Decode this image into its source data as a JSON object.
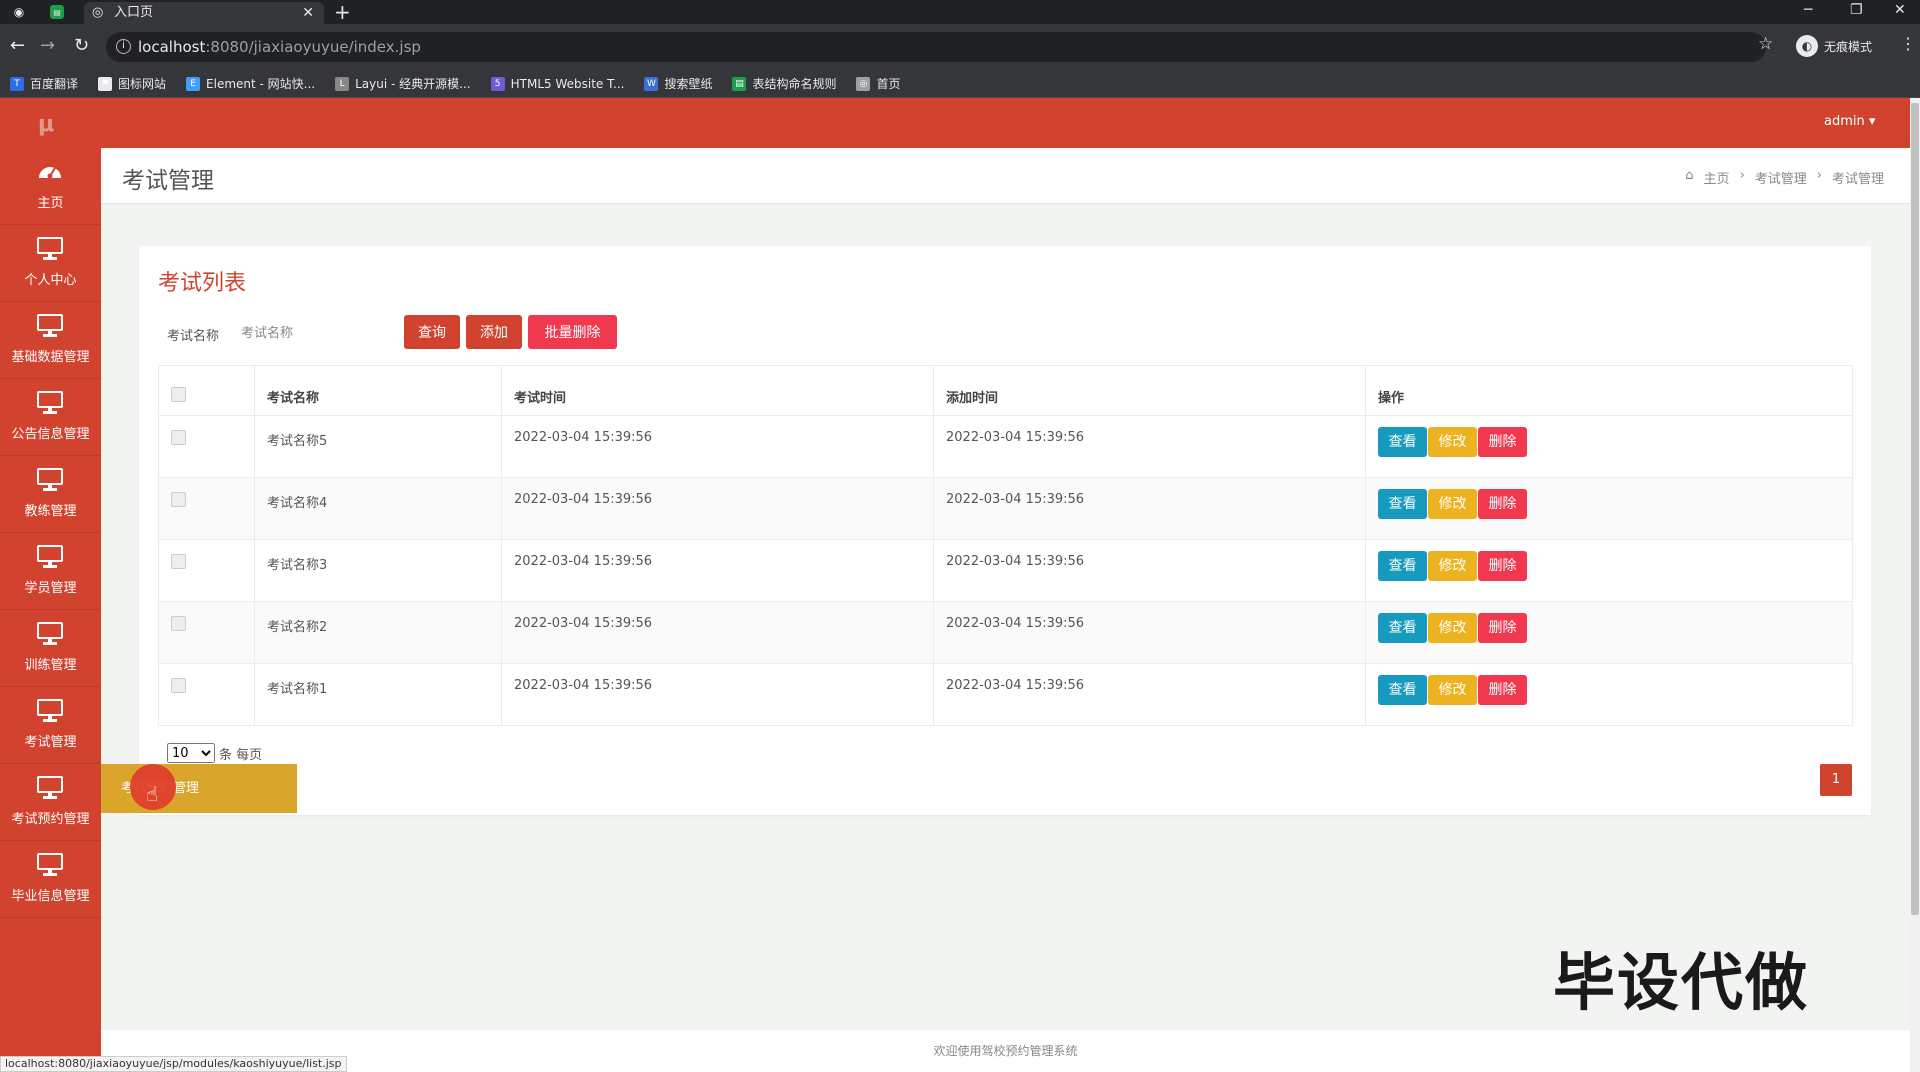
{
  "browser": {
    "tab_title": "入口页",
    "url_host": "localhost",
    "url_path": ":8080/jiaxiaoyuyue/index.jsp",
    "incognito_label": "无痕模式",
    "bookmarks": [
      {
        "label": "百度翻译",
        "color": "#2b6de4",
        "icon": "baidu-translate-icon",
        "glyph": "T"
      },
      {
        "label": "图标网站",
        "color": "#e8eaed",
        "icon": "flag-icon",
        "glyph": "⚑"
      },
      {
        "label": "Element - 网站快...",
        "color": "#409eff",
        "icon": "element-icon",
        "glyph": "E"
      },
      {
        "label": "Layui - 经典开源模...",
        "color": "#888888",
        "icon": "layui-icon",
        "glyph": "L"
      },
      {
        "label": "HTML5 Website T...",
        "color": "#6e5bd6",
        "icon": "html5-icon",
        "glyph": "5"
      },
      {
        "label": "搜索壁纸",
        "color": "#3b6fd8",
        "icon": "wallpaper-icon",
        "glyph": "W"
      },
      {
        "label": "表结构命名规则",
        "color": "#1e9e4a",
        "icon": "sheet-icon",
        "glyph": "▤"
      },
      {
        "label": "首页",
        "color": "#9aa0a6",
        "icon": "globe-icon",
        "glyph": "◎"
      }
    ],
    "status_url": "localhost:8080/jiaxiaoyuyue/jsp/modules/kaoshiyuyue/list.jsp"
  },
  "app": {
    "logo": "μ",
    "user_menu": "admin ▾",
    "sidebar": [
      {
        "label": "主页",
        "icon": "dashboard-icon"
      },
      {
        "label": "个人中心",
        "icon": "monitor-icon"
      },
      {
        "label": "基础数据管理",
        "icon": "monitor-icon"
      },
      {
        "label": "公告信息管理",
        "icon": "monitor-icon"
      },
      {
        "label": "教练管理",
        "icon": "monitor-icon"
      },
      {
        "label": "学员管理",
        "icon": "monitor-icon"
      },
      {
        "label": "训练管理",
        "icon": "monitor-icon"
      },
      {
        "label": "考试管理",
        "icon": "monitor-icon"
      },
      {
        "label": "考试预约管理",
        "icon": "monitor-icon"
      },
      {
        "label": "毕业信息管理",
        "icon": "monitor-icon"
      }
    ],
    "flyout_label": "考试预约管理",
    "page_title": "考试管理",
    "breadcrumb": [
      "主页",
      "考试管理",
      "考试管理"
    ],
    "card_title": "考试列表",
    "search": {
      "label": "考试名称",
      "placeholder": "考试名称"
    },
    "buttons": {
      "search": "查询",
      "add": "添加",
      "batch_delete": "批量删除"
    },
    "table": {
      "headers": [
        "考试名称",
        "考试时间",
        "添加时间",
        "操作"
      ],
      "rows": [
        {
          "name": "考试名称5",
          "exam_time": "2022-03-04 15:39:56",
          "add_time": "2022-03-04 15:39:56"
        },
        {
          "name": "考试名称4",
          "exam_time": "2022-03-04 15:39:56",
          "add_time": "2022-03-04 15:39:56"
        },
        {
          "name": "考试名称3",
          "exam_time": "2022-03-04 15:39:56",
          "add_time": "2022-03-04 15:39:56"
        },
        {
          "name": "考试名称2",
          "exam_time": "2022-03-04 15:39:56",
          "add_time": "2022-03-04 15:39:56"
        },
        {
          "name": "考试名称1",
          "exam_time": "2022-03-04 15:39:56",
          "add_time": "2022-03-04 15:39:56"
        }
      ],
      "actions": {
        "view": "查看",
        "edit": "修改",
        "delete": "删除"
      }
    },
    "pagination": {
      "page_size": "10",
      "page_size_options": [
        "10"
      ],
      "per_page_label": "条 每页",
      "current_page": "1"
    },
    "watermark": "毕设代做",
    "footer": "欢迎使用驾校预约管理系统"
  },
  "colors": {
    "primary": "#d2432f",
    "view": "#169bbf",
    "edit": "#ecb21f",
    "delete": "#f0394f",
    "flyout": "#d9a52a"
  }
}
